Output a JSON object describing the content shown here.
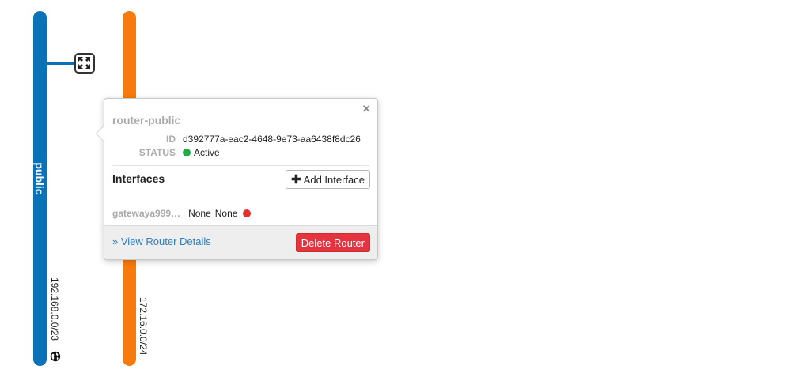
{
  "networks": [
    {
      "name": "public",
      "cidr": "192.168.0.0/23",
      "color": "#0b72b8",
      "external_icon": "globe-icon"
    },
    {
      "name": "",
      "cidr": "172.16.0.0/24",
      "color": "#f77b0c"
    }
  ],
  "router_icon": "router-icon",
  "popup": {
    "close_label": "×",
    "router_name": "router-public",
    "id_key": "ID",
    "id_value": "d392777a-eac2-4648-9e73-aa6438f8dc26",
    "status_key": "STATUS",
    "status_value": "Active",
    "status_color": "#22aa44",
    "interfaces_title": "Interfaces",
    "add_interface_label": "Add Interface",
    "interfaces": [
      {
        "name": "gatewaya999…",
        "ip": "None",
        "status": "None",
        "status_color": "#e3302f"
      }
    ],
    "view_details_label": "» View Router Details",
    "delete_label": "Delete Router",
    "delete_color": "#e5333f"
  }
}
